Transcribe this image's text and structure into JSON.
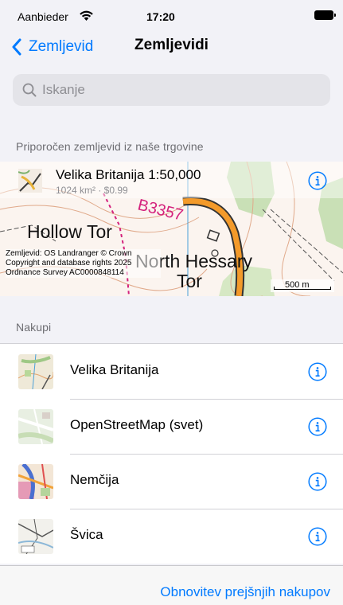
{
  "status_bar": {
    "carrier": "Aanbieder",
    "time": "17:20"
  },
  "nav": {
    "back_label": "Zemljevid",
    "title": "Zemljevidi"
  },
  "search": {
    "placeholder": "Iskanje",
    "value": ""
  },
  "featured": {
    "header": "Priporočen zemljevid iz naše trgovine",
    "title": "Velika Britanija 1:50,000",
    "subtitle": "1024 km² · $0.99",
    "attribution": "Zemljevid: OS Landranger © Crown Copyright and database rights 2025 Ordnance Survey AC0000848114",
    "scale": "500 m",
    "map_labels": {
      "road": "B3357",
      "place1": "Hollow Tor",
      "place2": "North Hessary",
      "place3": "Tor"
    }
  },
  "purchases": {
    "header": "Nakupi",
    "items": [
      {
        "label": "Velika Britanija",
        "icon": "gb-map-thumbnail"
      },
      {
        "label": "OpenStreetMap (svet)",
        "icon": "osm-map-thumbnail"
      },
      {
        "label": "Nemčija",
        "icon": "de-map-thumbnail"
      },
      {
        "label": "Švica",
        "icon": "ch-map-thumbnail"
      }
    ]
  },
  "footer": {
    "restore_label": "Obnovitev prejšnjih nakupov"
  },
  "colors": {
    "accent": "#007aff",
    "background": "#f2f2f7",
    "secondary_text": "#6d6d72"
  }
}
